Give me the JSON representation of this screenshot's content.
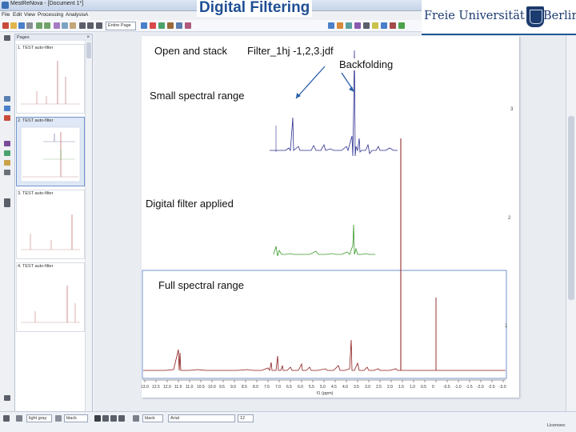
{
  "window": {
    "title": "MestReNova - [Document 1*]"
  },
  "menu": [
    "File",
    "Edit",
    "View",
    "Processing",
    "Analysis",
    "A"
  ],
  "toolbar": {
    "combo_value": "Entire Page"
  },
  "slide": {
    "title": "Digital Filtering"
  },
  "logo": {
    "left_text": "Freie Universität",
    "right_text": "Berlin"
  },
  "pages_panel": {
    "header": "Pages",
    "close": "×",
    "thumbs": [
      {
        "label": "1. TEST auto-filter"
      },
      {
        "label": "2. TEST auto-filter"
      },
      {
        "label": "3. TEST auto-filter"
      },
      {
        "label": "4. TEST auto-filter"
      }
    ]
  },
  "annotations": {
    "open_and_stack": "Open and stack",
    "filter_file": "Filter_1hj -1,2,3.jdf",
    "backfolding": "Backfolding",
    "small_range": "Small spectral range",
    "digital_filter": "Digital filter applied",
    "full_range": "Full spectral range"
  },
  "spectrum": {
    "trace_labels": [
      "3",
      "2",
      "1"
    ],
    "axis_ticks": [
      "13.0",
      "12.5",
      "12.0",
      "11.5",
      "11.0",
      "10.5",
      "10.0",
      "9.5",
      "9.0",
      "8.5",
      "8.0",
      "7.5",
      "7.0",
      "6.5",
      "6.0",
      "5.5",
      "5.0",
      "4.5",
      "4.0",
      "3.5",
      "3.0",
      "2.5",
      "2.0",
      "1.5",
      "1.0",
      "0.5",
      "0",
      "-0.5",
      "-1.0",
      "-1.5",
      "-2.0",
      "-2.5",
      "-3.0"
    ],
    "axis_label": "f1 (ppm)"
  },
  "bottom": {
    "color_combo": "light gray",
    "color2_combo": "black",
    "color3_combo": "black",
    "font_combo": "Arial",
    "size_combo": "12"
  },
  "status": {
    "licenses": "Licenses:"
  },
  "colors": {
    "blue_trace": "#2c2f8f",
    "green_trace": "#3a9a2a",
    "red_trace": "#8b1a1a",
    "title": "#1f4f94",
    "selection": "#6f94cc"
  }
}
